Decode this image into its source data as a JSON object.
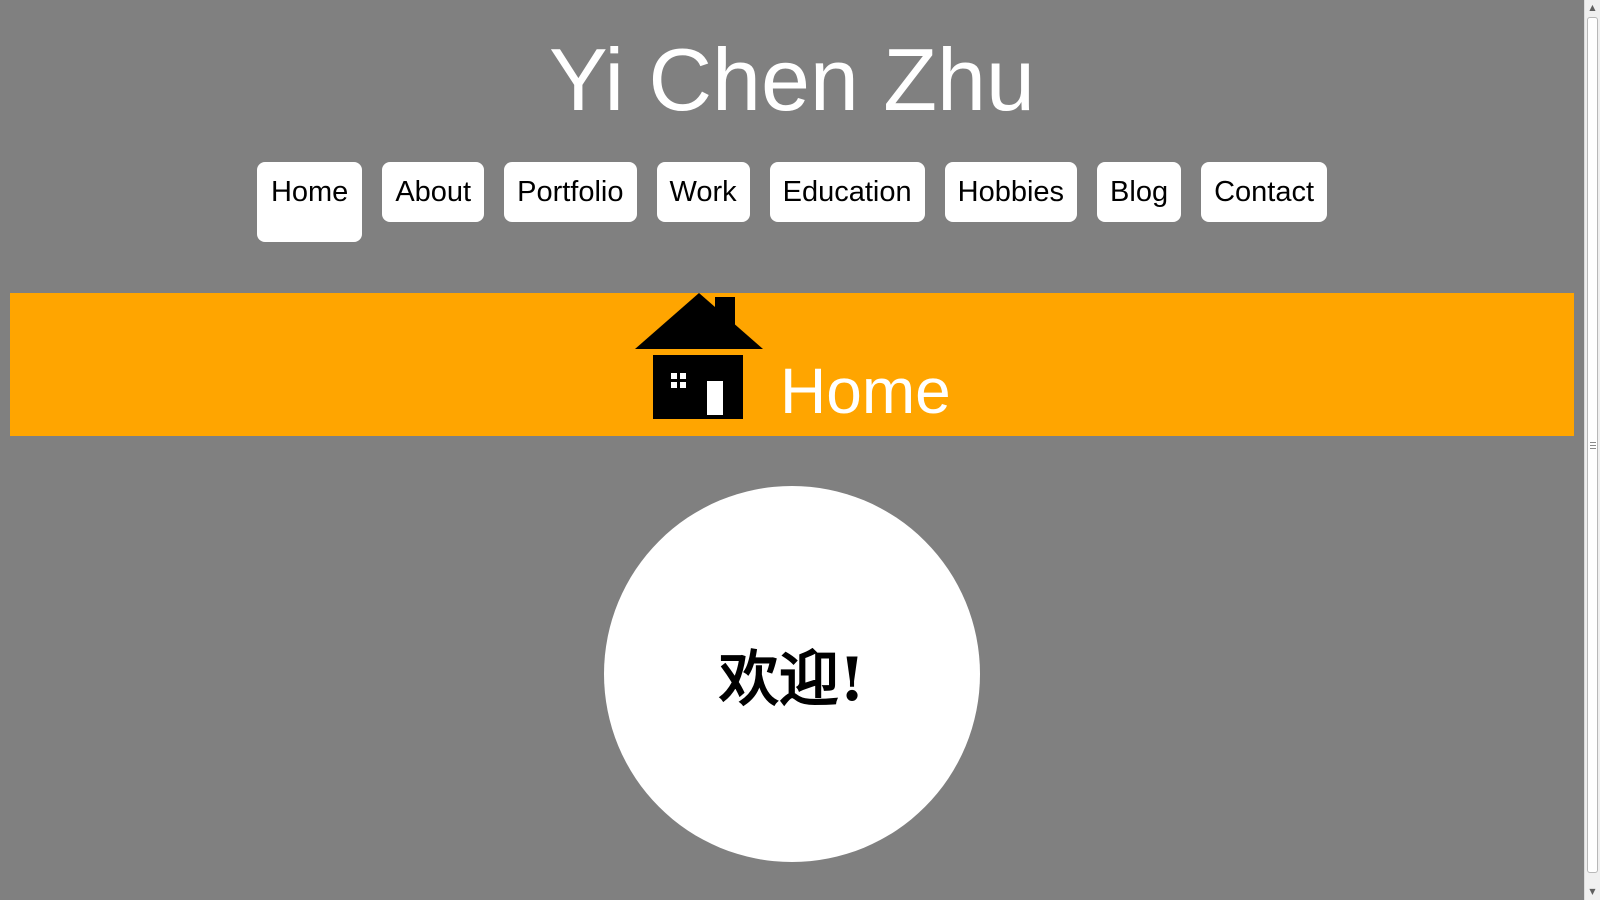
{
  "header": {
    "title": "Yi Chen Zhu"
  },
  "nav": {
    "items": [
      {
        "label": "Home",
        "active": true
      },
      {
        "label": "About",
        "active": false
      },
      {
        "label": "Portfolio",
        "active": false
      },
      {
        "label": "Work",
        "active": false
      },
      {
        "label": "Education",
        "active": false
      },
      {
        "label": "Hobbies",
        "active": false
      },
      {
        "label": "Blog",
        "active": false
      },
      {
        "label": "Contact",
        "active": false
      }
    ]
  },
  "banner": {
    "title": "Home",
    "icon": "house-icon",
    "color": "#ffa500"
  },
  "welcome": {
    "text": "欢迎!"
  },
  "colors": {
    "background": "#808080",
    "nav_button": "#ffffff",
    "banner": "#ffa500"
  }
}
